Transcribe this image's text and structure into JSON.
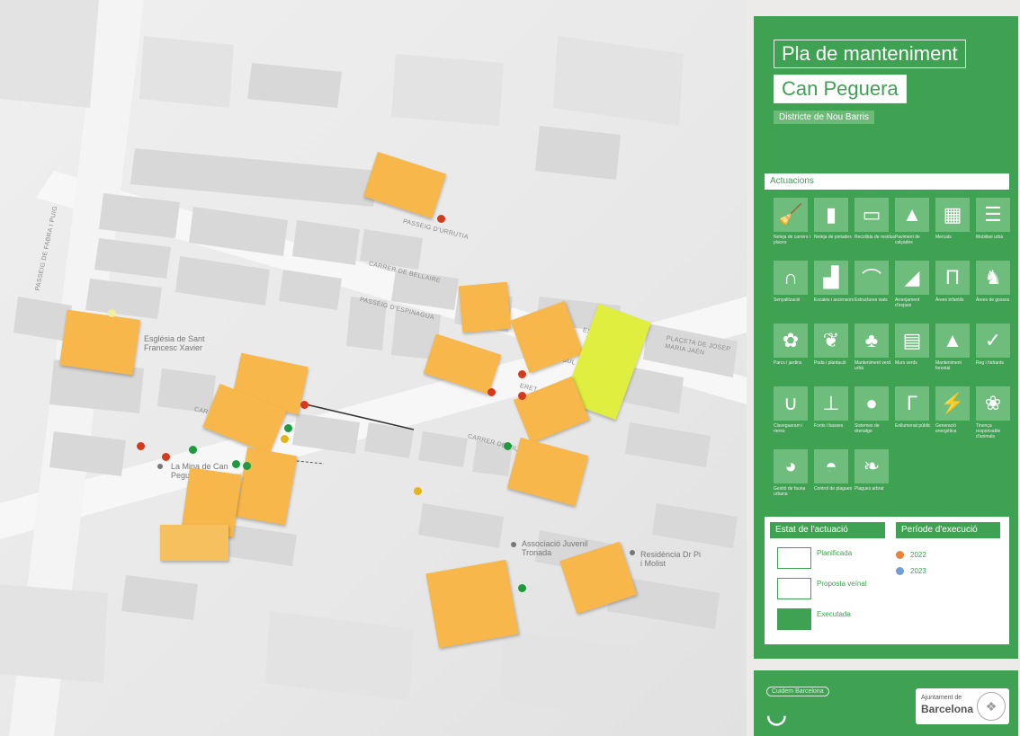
{
  "panel": {
    "title_line1": "Pla de manteniment",
    "title_line2": "Can Peguera",
    "district": "Districte de Nou Barris",
    "actuacions_heading": "Actuacions",
    "tiles": [
      {
        "label": "Neteja de carrers i places",
        "icon": "broom-bucket-icon"
      },
      {
        "label": "Neteja de pintades",
        "icon": "paint-roller-icon"
      },
      {
        "label": "Recollida de residus",
        "icon": "bin-icon"
      },
      {
        "label": "Paviment de calçades",
        "icon": "road-icon"
      },
      {
        "label": "Mercats",
        "icon": "grid-icon"
      },
      {
        "label": "Mobiliari urbà",
        "icon": "bench-icon"
      },
      {
        "label": "Senyalització",
        "icon": "u-turn-icon"
      },
      {
        "label": "Escales i ascensors",
        "icon": "stairs-icon"
      },
      {
        "label": "Estructures vials",
        "icon": "bridge-icon"
      },
      {
        "label": "Arranjament d'espais",
        "icon": "trowel-icon"
      },
      {
        "label": "Àrees infantils",
        "icon": "swing-icon"
      },
      {
        "label": "Àrees de gossos",
        "icon": "dog-icon"
      },
      {
        "label": "Parcs i jardins",
        "icon": "flower-icon"
      },
      {
        "label": "Poda i plantació",
        "icon": "leaf-icon"
      },
      {
        "label": "Manteniment verd urbà",
        "icon": "pot-plant-icon"
      },
      {
        "label": "Murs verds",
        "icon": "wall-plant-icon"
      },
      {
        "label": "Manteniment forestal",
        "icon": "tree-icon"
      },
      {
        "label": "Reg i hidrants",
        "icon": "check-icon"
      },
      {
        "label": "Clavegueram i rieres",
        "icon": "sewer-icon"
      },
      {
        "label": "Fonts i basses",
        "icon": "fountain-icon"
      },
      {
        "label": "Sistemes de drenatge",
        "icon": "drop-icon"
      },
      {
        "label": "Enllumenat públic",
        "icon": "streetlight-icon"
      },
      {
        "label": "Generació energètica",
        "icon": "lightning-icon"
      },
      {
        "label": "Tinença responsable d'animals",
        "icon": "paw-icon"
      },
      {
        "label": "Gestió de fauna urbana",
        "icon": "bird-icon"
      },
      {
        "label": "Control de plagues",
        "icon": "rat-icon"
      },
      {
        "label": "Plagues arbrat",
        "icon": "leaf-pest-icon"
      }
    ],
    "status_heading": "Estat de l'actuació",
    "period_heading": "Període d'execució",
    "status_items": [
      "Planificada",
      "Proposta veïnal",
      "Executada"
    ],
    "periods": [
      {
        "label": "2022",
        "color": "#e8843a"
      },
      {
        "label": "2023",
        "color": "#6e9fd6"
      }
    ],
    "footer_tag": "Cuidem Barcelona",
    "footer_org_line1": "Ajuntament de",
    "footer_org_line2": "Barcelona"
  },
  "map": {
    "streets": [
      "PASSEIG D'URRUTIA",
      "CARRER DE BELLAIRE",
      "PASSEIG D'ESPINAGUA",
      "CARRER DE VILA",
      "PASSEIG DE FABRA I PUIG",
      "PLAÇETA DE JOSEP MARIA JAÉN",
      "CAR",
      "AGUL",
      "ERET",
      "ESC"
    ],
    "places": [
      "Església de Sant Francesc Xavier",
      "La Mina de Can Peguera",
      "Associació Juvenil Tronada",
      "Residència Dr Pi i Molist"
    ]
  }
}
